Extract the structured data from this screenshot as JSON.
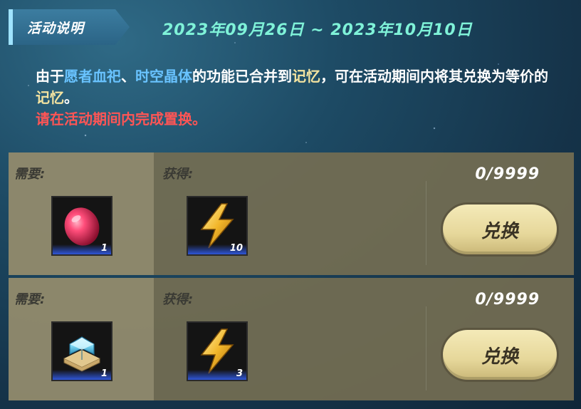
{
  "header": {
    "title": "活动说明",
    "date_range": "2023年09月26日 ~ 2023年10月10日"
  },
  "description": {
    "part1": "由于",
    "item_a": "愿者血祀",
    "sep": "、",
    "item_b": "时空晶体",
    "part2": "的功能已合并到",
    "memory_1": "记忆",
    "part3": "，可在活动期间内将其兑换为等价的",
    "memory_2": "记忆",
    "part4": "。",
    "warning": "请在活动期间内完成置换。"
  },
  "rows": [
    {
      "need_label": "需要:",
      "get_label": "获得:",
      "need_item": {
        "icon": "red-gem-icon",
        "qty": "1"
      },
      "get_item": {
        "icon": "lightning-memory-icon",
        "qty": "10"
      },
      "count": "0/9999",
      "button_label": "兑换"
    },
    {
      "need_label": "需要:",
      "get_label": "获得:",
      "need_item": {
        "icon": "spacetime-crystal-icon",
        "qty": "1"
      },
      "get_item": {
        "icon": "lightning-memory-icon",
        "qty": "3"
      },
      "count": "0/9999",
      "button_label": "兑换"
    }
  ],
  "colors": {
    "date": "#7ff2d8",
    "highlight_blue": "#69c3ff",
    "highlight_gold": "#f3e3a0",
    "warning": "#ff5555",
    "button": "#e6d79a"
  }
}
